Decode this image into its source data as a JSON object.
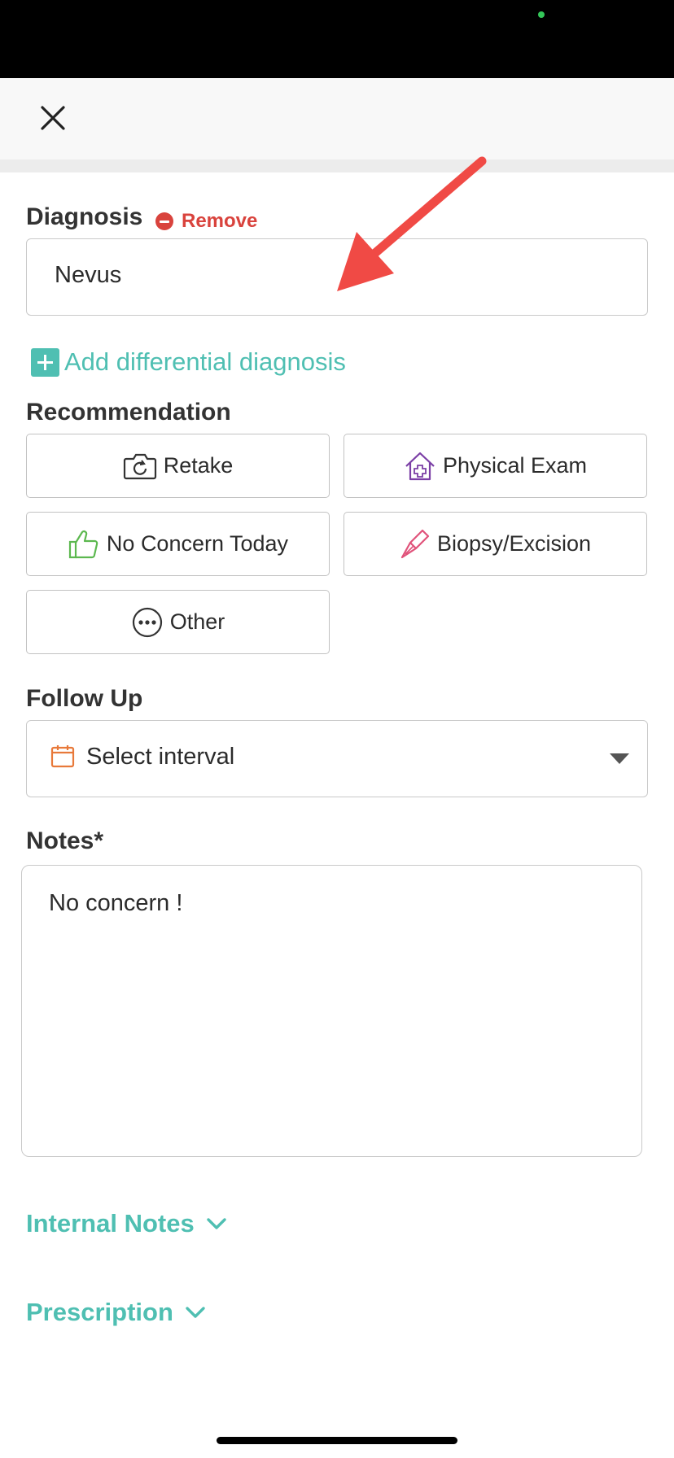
{
  "header": {
    "close_icon": "close-icon"
  },
  "diagnosis": {
    "label": "Diagnosis",
    "remove_label": "Remove",
    "value": "Nevus",
    "add_differential_label": "Add differential diagnosis"
  },
  "recommendation": {
    "label": "Recommendation",
    "options": [
      {
        "label": "Retake",
        "icon": "camera-retake-icon"
      },
      {
        "label": "Physical Exam",
        "icon": "house-medical-icon"
      },
      {
        "label": "No Concern Today",
        "icon": "thumbs-up-icon"
      },
      {
        "label": "Biopsy/Excision",
        "icon": "scalpel-icon"
      },
      {
        "label": "Other",
        "icon": "more-dots-icon"
      }
    ]
  },
  "follow_up": {
    "label": "Follow Up",
    "placeholder": "Select interval",
    "icon": "calendar-icon"
  },
  "notes": {
    "label": "Notes*",
    "value": "No concern !"
  },
  "sections": {
    "internal_notes": "Internal Notes",
    "prescription": "Prescription"
  },
  "colors": {
    "accent": "#4fbfb2",
    "danger": "#d9433d",
    "annotation_arrow": "#f04a45"
  }
}
